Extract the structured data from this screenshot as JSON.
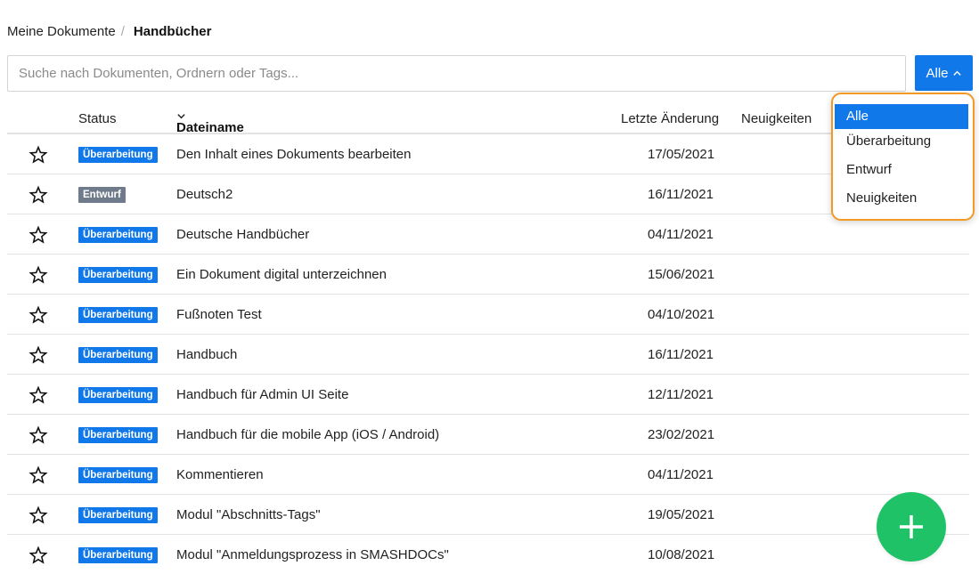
{
  "breadcrumb": {
    "root": "Meine Dokumente",
    "separator": "/",
    "current": "Handbücher"
  },
  "search": {
    "placeholder": "Suche nach Dokumenten, Ordnern oder Tags...",
    "value": ""
  },
  "filter": {
    "label": "Alle",
    "icon": "chevron-up-icon",
    "options": [
      "Alle",
      "Überarbeitung",
      "Entwurf",
      "Neuigkeiten"
    ],
    "selected": "Alle"
  },
  "table": {
    "headers": {
      "status": "Status",
      "name": "Dateiname",
      "date": "Letzte Änderung",
      "news": "Neuigkeiten"
    },
    "sort_icon": "chevron-down-icon",
    "rows": [
      {
        "status": "Überarbeitung",
        "status_kind": "revision",
        "name": "Den Inhalt eines Dokuments bearbeiten",
        "date": "17/05/2021"
      },
      {
        "status": "Entwurf",
        "status_kind": "draft",
        "name": "Deutsch2",
        "date": "16/11/2021"
      },
      {
        "status": "Überarbeitung",
        "status_kind": "revision",
        "name": "Deutsche Handbücher",
        "date": "04/11/2021"
      },
      {
        "status": "Überarbeitung",
        "status_kind": "revision",
        "name": "Ein Dokument digital unterzeichnen",
        "date": "15/06/2021"
      },
      {
        "status": "Überarbeitung",
        "status_kind": "revision",
        "name": "Fußnoten Test",
        "date": "04/10/2021"
      },
      {
        "status": "Überarbeitung",
        "status_kind": "revision",
        "name": "Handbuch",
        "date": "16/11/2021"
      },
      {
        "status": "Überarbeitung",
        "status_kind": "revision",
        "name": "Handbuch für Admin UI Seite",
        "date": "12/11/2021"
      },
      {
        "status": "Überarbeitung",
        "status_kind": "revision",
        "name": "Handbuch für die mobile App (iOS / Android)",
        "date": "23/02/2021"
      },
      {
        "status": "Überarbeitung",
        "status_kind": "revision",
        "name": "Kommentieren",
        "date": "04/11/2021"
      },
      {
        "status": "Überarbeitung",
        "status_kind": "revision",
        "name": "Modul \"Abschnitts-Tags\"",
        "date": "19/05/2021"
      },
      {
        "status": "Überarbeitung",
        "status_kind": "revision",
        "name": "Modul \"Anmeldungsprozess in SMASHDOCs\"",
        "date": "10/08/2021"
      }
    ]
  },
  "fab": {
    "icon": "plus-icon"
  },
  "colors": {
    "accent": "#1178ea",
    "draft_badge": "#6f7b8a",
    "fab": "#1fc267",
    "dropdown_highlight": "#f29a23"
  }
}
